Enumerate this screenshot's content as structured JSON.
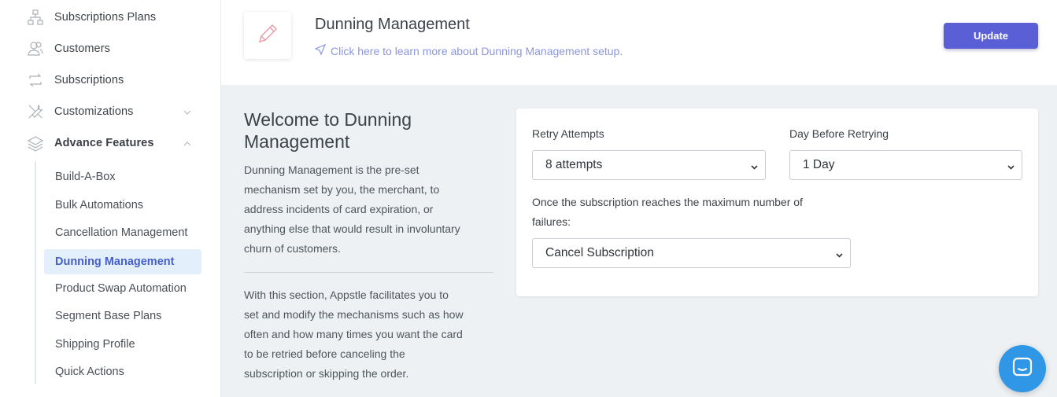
{
  "sidebar": {
    "items": [
      {
        "label": "Subscriptions Plans",
        "icon": "sitemap-icon"
      },
      {
        "label": "Customers",
        "icon": "users-icon"
      },
      {
        "label": "Subscriptions",
        "icon": "repeat-icon"
      },
      {
        "label": "Customizations",
        "icon": "tools-icon"
      },
      {
        "label": "Advance Features",
        "icon": "layers-icon"
      }
    ],
    "sub_items": [
      "Build-A-Box",
      "Bulk Automations",
      "Cancellation Management",
      "Dunning Management",
      "Product Swap Automation",
      "Segment Base Plans",
      "Shipping Profile",
      "Quick Actions"
    ],
    "active_sub_item": "Dunning Management"
  },
  "header": {
    "title": "Dunning Management",
    "help_link": "Click here to learn more about Dunning Management setup.",
    "update_label": "Update",
    "icon": "pencil-icon"
  },
  "intro": {
    "title": "Welcome to Dunning Management",
    "paragraph1_lines": [
      "Dunning Management is the pre-set",
      "mechanism set by you, the merchant, to",
      "address incidents of card expiration, or",
      "anything else that would result in involuntary",
      "churn of customers."
    ],
    "paragraph2_lines": [
      "With this section, Appstle facilitates you to",
      "set and modify the mechanisms such as how",
      "often and how many times you want the card",
      "to be retried before canceling the",
      "subscription or skipping the order."
    ]
  },
  "settings": {
    "retry_attempts_label": "Retry Attempts",
    "retry_attempts_value": "8 attempts",
    "day_before_retrying_label": "Day Before Retrying",
    "day_before_retrying_value": "1 Day",
    "max_failures_label_lines": [
      "Once the subscription reaches the maximum number of",
      "failures:"
    ],
    "max_failures_value": "Cancel Subscription"
  },
  "colors": {
    "accent": "#5b5fd6",
    "link": "#8c95e0",
    "active_bg": "#e3f0fb",
    "active_text": "#4660c8",
    "chat": "#2f97e6"
  }
}
